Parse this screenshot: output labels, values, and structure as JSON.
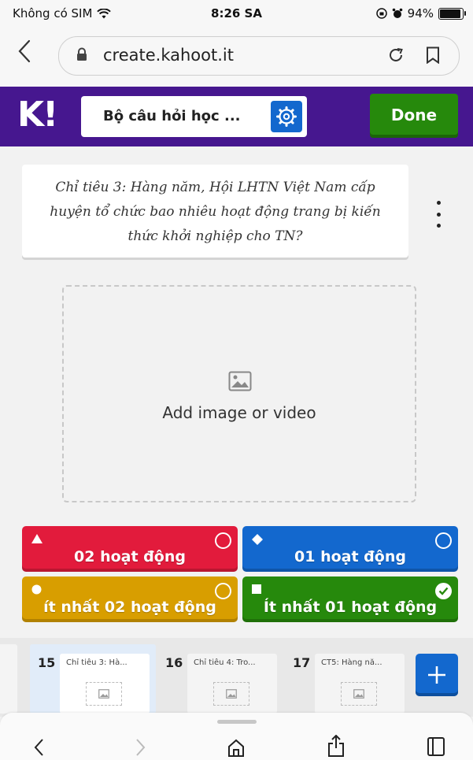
{
  "status": {
    "carrier": "Không có SIM",
    "time": "8:26 SA",
    "battery": "94%",
    "battery_level": 0.94
  },
  "browser": {
    "url": "create.kahoot.it"
  },
  "header": {
    "logo": "K!",
    "kahoot_title": "Bộ câu hỏi học ...",
    "done_label": "Done",
    "brand_color": "#46178f"
  },
  "question": {
    "text": "Chỉ tiêu 3: Hàng năm, Hội LHTN Việt Nam cấp huyện tổ chức bao nhiêu hoạt động trang bị kiến thức khởi nghiệp cho TN?"
  },
  "media": {
    "label": "Add image or video"
  },
  "answers": [
    {
      "label": "02 hoạt động",
      "color": "#e21b3c",
      "shape": "triangle",
      "correct": false
    },
    {
      "label": "01 hoạt động",
      "color": "#1368ce",
      "shape": "diamond",
      "correct": false
    },
    {
      "label": "ít nhất 02 hoạt động",
      "color": "#d89e00",
      "shape": "circle",
      "correct": false
    },
    {
      "label": "Ít nhất 01 hoạt động",
      "color": "#26890c",
      "shape": "square",
      "correct": true
    }
  ],
  "slides": [
    {
      "number": "15",
      "title": "Chỉ tiêu 3: Hà...",
      "active": true
    },
    {
      "number": "16",
      "title": "Chỉ tiêu 4: Tro...",
      "active": false
    },
    {
      "number": "17",
      "title": "CT5: Hàng nă...",
      "active": false
    }
  ]
}
